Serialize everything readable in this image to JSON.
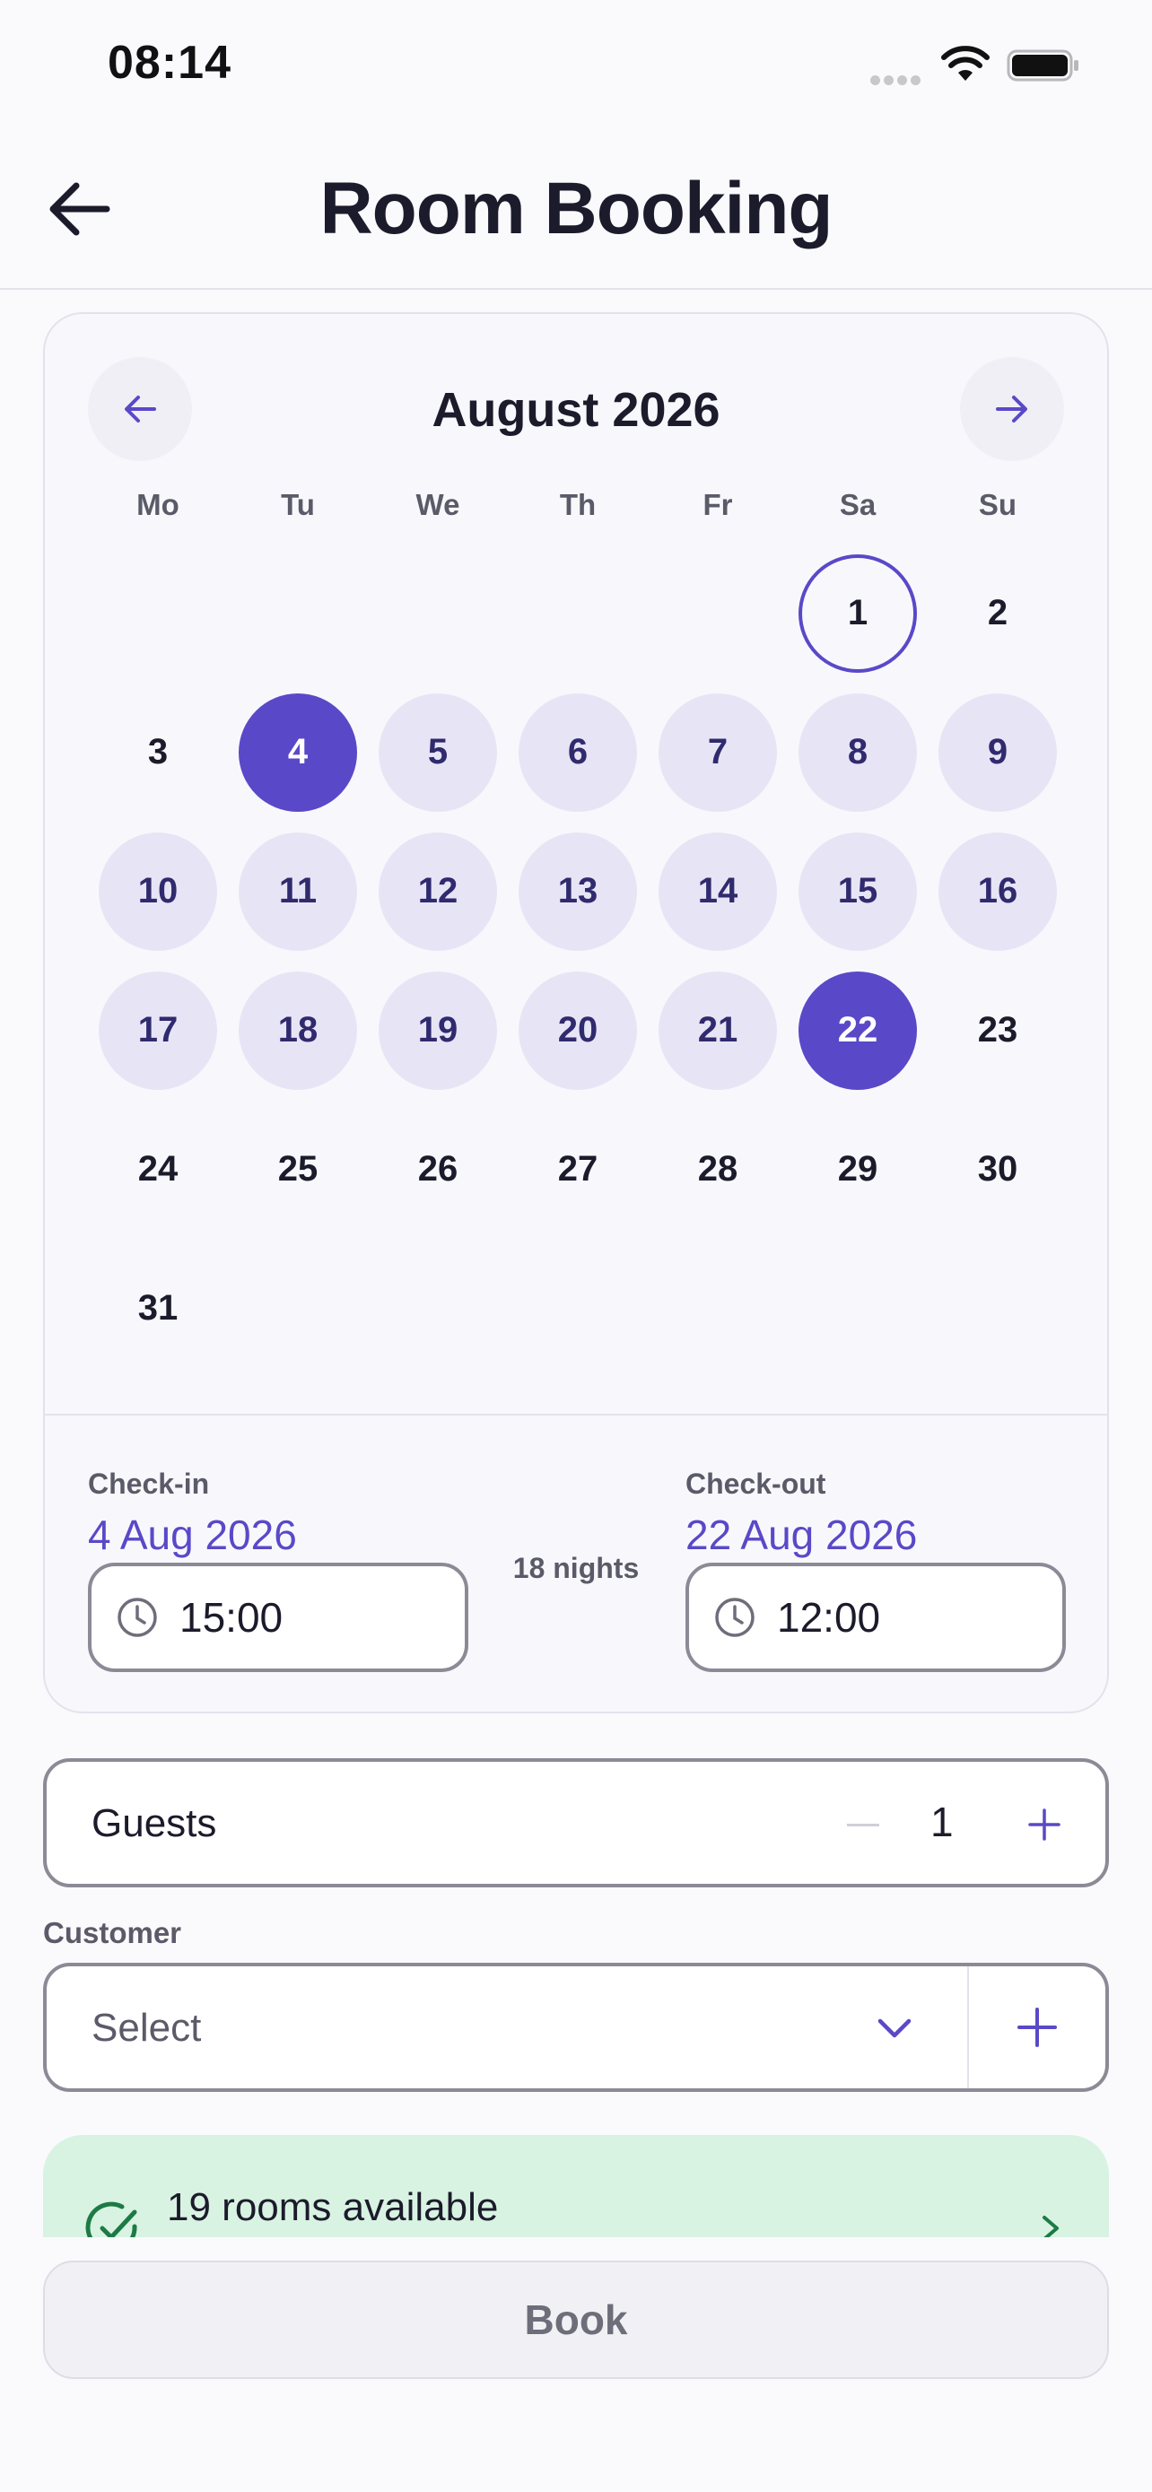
{
  "status_bar": {
    "time": "08:14"
  },
  "header": {
    "title": "Room Booking"
  },
  "calendar": {
    "month": "August 2026",
    "weekdays": [
      "Mo",
      "Tu",
      "We",
      "Th",
      "Fr",
      "Sa",
      "Su"
    ],
    "leading_blanks": 5,
    "days_in_month": 31,
    "today": 1,
    "range_start": 4,
    "range_end": 22
  },
  "booking": {
    "checkin_label": "Check-in",
    "checkin_date": "4 Aug 2026",
    "checkin_time": "15:00",
    "checkout_label": "Check-out",
    "checkout_date": "22 Aug 2026",
    "checkout_time": "12:00",
    "nights": "18 nights"
  },
  "guests": {
    "label": "Guests",
    "count": "1"
  },
  "customer": {
    "label": "Customer",
    "placeholder": "Select"
  },
  "availability": {
    "text": "19 rooms available"
  },
  "book_button": {
    "label": "Book"
  },
  "colors": {
    "accent": "#5949c8",
    "range": "#e7e5f5",
    "available_bg": "#d8f3e2",
    "available_icon": "#1e7a45"
  },
  "icons": {
    "back": "arrow-left-icon",
    "prev_month": "arrow-left-icon",
    "next_month": "arrow-right-icon",
    "time": "clock-icon",
    "dropdown": "chevron-down-icon",
    "add": "plus-icon",
    "available": "check-circle-icon",
    "more": "chevron-right-icon"
  }
}
